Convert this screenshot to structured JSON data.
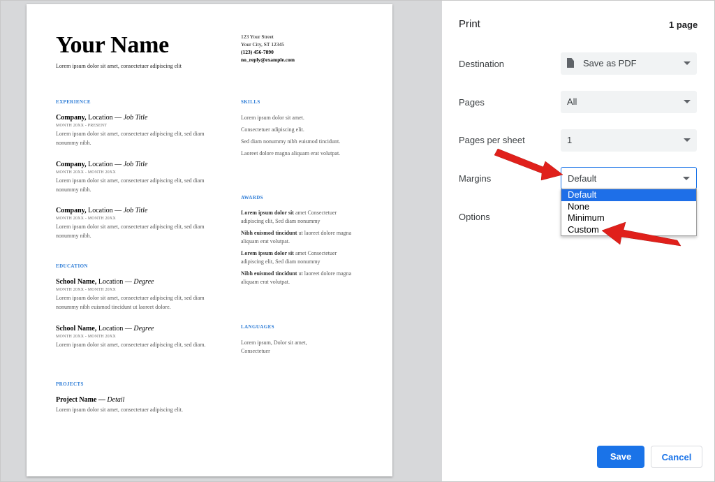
{
  "resume": {
    "name": "Your Name",
    "tagline": "Lorem ipsum dolor sit amet, consectetuer adipiscing elit",
    "contact": [
      "123 Your Street",
      "Your City, ST 12345",
      "(123) 456-7890",
      "no_reply@example.com"
    ],
    "sections": {
      "experience": "EXPERIENCE",
      "education": "EDUCATION",
      "projects": "PROJECTS",
      "skills": "SKILLS",
      "awards": "AWARDS",
      "languages": "LANGUAGES"
    },
    "experience": [
      {
        "org": "Company,",
        "loc": " Location — ",
        "role": "Job Title",
        "date": "MONTH 20XX - PRESENT",
        "text": "Lorem ipsum dolor sit amet, consectetuer adipiscing elit, sed diam nonummy nibh."
      },
      {
        "org": "Company,",
        "loc": " Location — ",
        "role": "Job Title",
        "date": "MONTH 20XX - MONTH 20XX",
        "text": "Lorem ipsum dolor sit amet, consectetuer adipiscing elit, sed diam nonummy nibh."
      },
      {
        "org": "Company,",
        "loc": " Location — ",
        "role": "Job Title",
        "date": "MONTH 20XX - MONTH 20XX",
        "text": "Lorem ipsum dolor sit amet, consectetuer adipiscing elit, sed diam nonummy nibh."
      }
    ],
    "education": [
      {
        "org": "School Name,",
        "loc": " Location — ",
        "role": "Degree",
        "date": "MONTH 20XX - MONTH 20XX",
        "text": "Lorem ipsum dolor sit amet, consectetuer adipiscing elit, sed diam nonummy nibh euismod tincidunt ut laoreet dolore."
      },
      {
        "org": "School Name,",
        "loc": " Location — ",
        "role": "Degree",
        "date": "MONTH 20XX - MONTH 20XX",
        "text": "Lorem ipsum dolor sit amet, consectetuer adipiscing elit, sed diam."
      }
    ],
    "project": {
      "title": "Project Name — ",
      "detail": "Detail",
      "text": "Lorem ipsum dolor sit amet, consectetuer adipiscing elit."
    },
    "skills": [
      "Lorem ipsum dolor sit amet.",
      "Consectetuer adipiscing elit.",
      "Sed diam nonummy nibh euismod tincidunt.",
      "Laoreet dolore magna aliquam erat volutpat."
    ],
    "awards": [
      {
        "bold": "Lorem ipsum dolor sit",
        "rest": " amet Consectetuer adipiscing elit, Sed diam nonummy"
      },
      {
        "bold": "Nibh euismod tincidunt",
        "rest": " ut laoreet dolore magna aliquam erat volutpat."
      },
      {
        "bold": "Lorem ipsum dolor sit",
        "rest": " amet Consectetuer adipiscing elit, Sed diam nonummy"
      },
      {
        "bold": "Nibh euismod tincidunt",
        "rest": " ut laoreet dolore magna aliquam erat volutpat."
      }
    ],
    "languages": "Lorem ipsum, Dolor sit amet, Consectetuer"
  },
  "print": {
    "title": "Print",
    "page_count": "1 page",
    "destination": {
      "label": "Destination",
      "value": "Save as PDF",
      "icon": "pdf-file-icon"
    },
    "pages": {
      "label": "Pages",
      "value": "All"
    },
    "pages_per_sheet": {
      "label": "Pages per sheet",
      "value": "1"
    },
    "margins": {
      "label": "Margins",
      "value": "Default",
      "options": [
        "Default",
        "None",
        "Minimum",
        "Custom"
      ]
    },
    "options_label": "Options",
    "save_label": "Save",
    "cancel_label": "Cancel"
  },
  "colors": {
    "accent": "#1a73e8",
    "annotation": "#e0201b"
  }
}
